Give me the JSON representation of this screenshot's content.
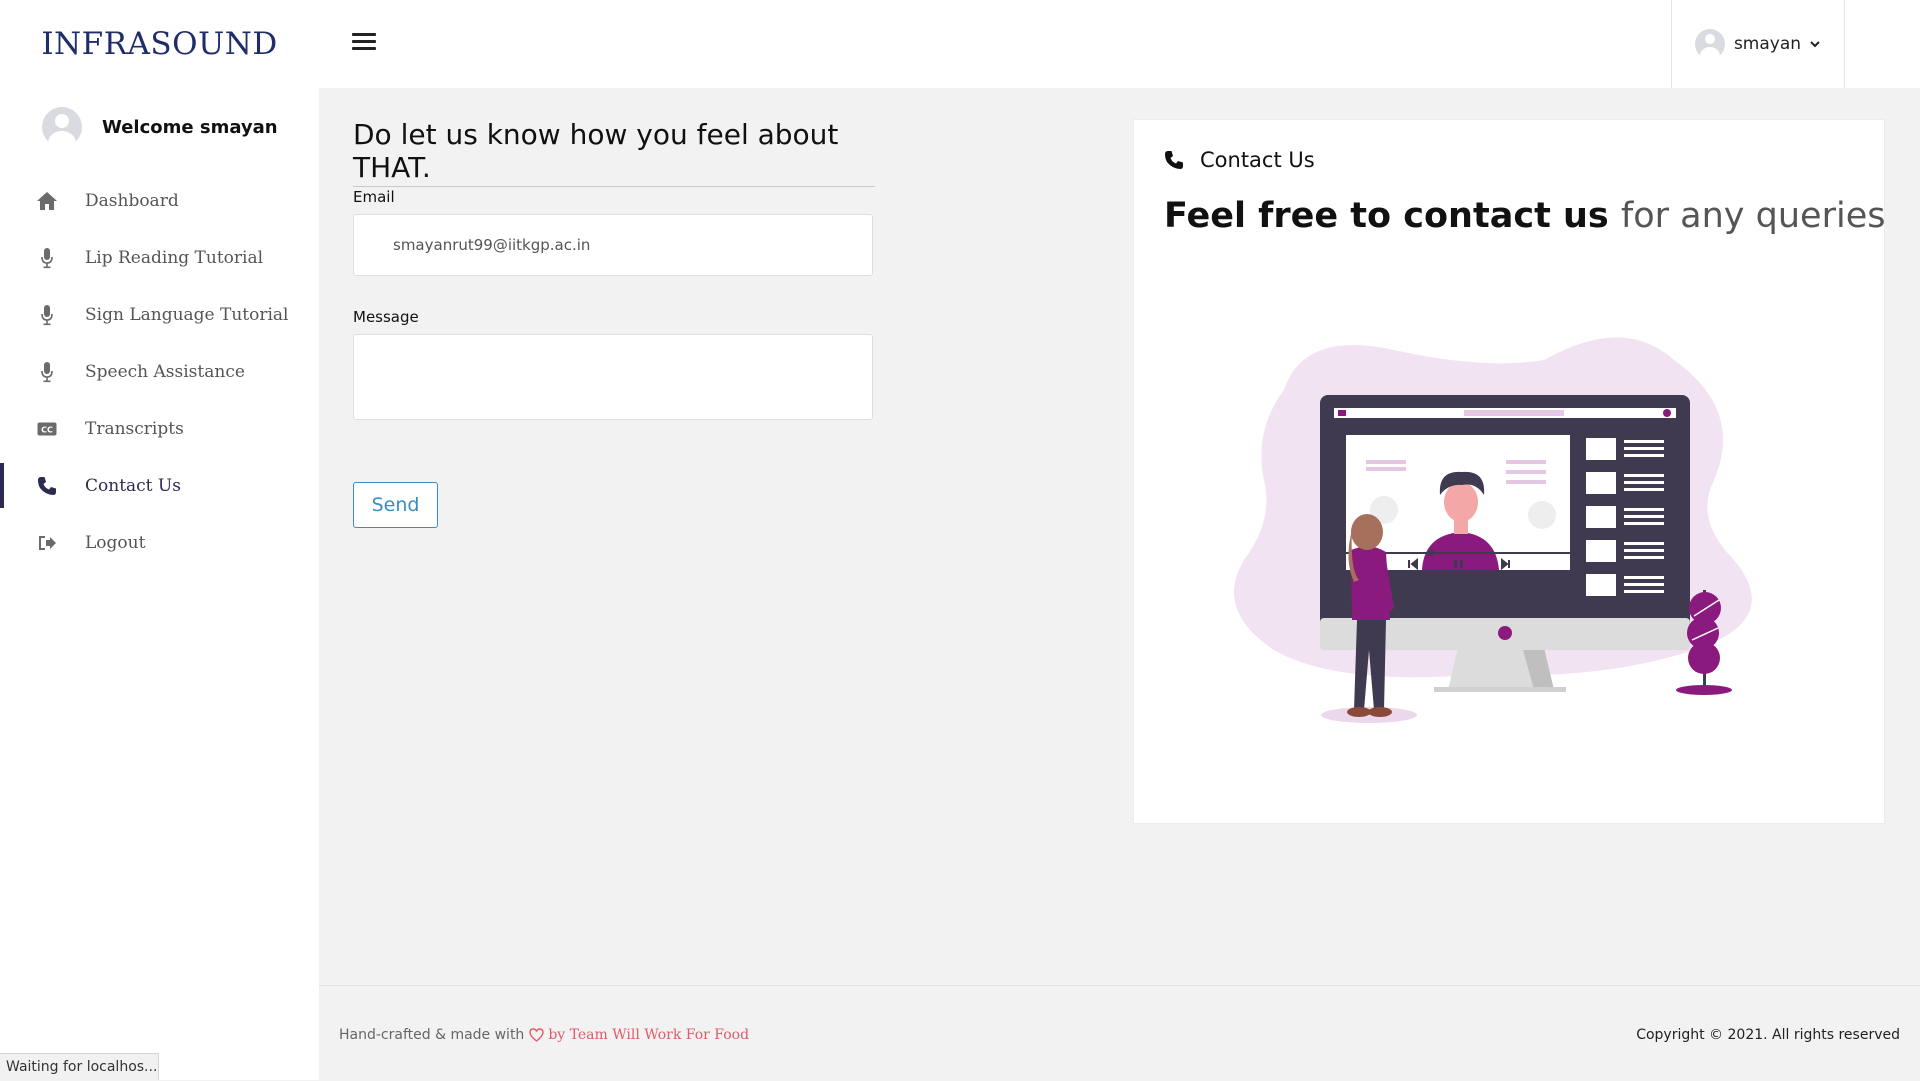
{
  "brand": "INFRASOUND",
  "sidebar": {
    "welcome": "Welcome smayan",
    "items": [
      {
        "label": "Dashboard",
        "icon": "home-icon"
      },
      {
        "label": "Lip Reading Tutorial",
        "icon": "microphone-icon"
      },
      {
        "label": "Sign Language Tutorial",
        "icon": "microphone-icon"
      },
      {
        "label": "Speech Assistance",
        "icon": "microphone-icon"
      },
      {
        "label": "Transcripts",
        "icon": "closed-caption-icon"
      },
      {
        "label": "Contact Us",
        "icon": "phone-icon",
        "active": true
      },
      {
        "label": "Logout",
        "icon": "logout-icon"
      }
    ]
  },
  "header": {
    "user": "smayan"
  },
  "form": {
    "title": "Do let us know how you feel about THAT.",
    "email_label": "Email",
    "email_value": "smayanrut99@iitkgp.ac.in",
    "message_label": "Message",
    "message_value": "",
    "send_label": "Send"
  },
  "card": {
    "header_label": "Contact Us",
    "title_bold": "Feel free to contact us",
    "title_light": "for any queries"
  },
  "footer": {
    "left_text": "Hand-crafted & made with",
    "team": "by Team Will Work For Food",
    "copyright": "Copyright © 2021. All rights reserved"
  },
  "status_bar": "Waiting for localhos...",
  "colors": {
    "brand": "#1f2d6b",
    "accent": "#3a8cc1",
    "illustration_purple": "#8b1a7e",
    "heart": "#e05a6a"
  }
}
